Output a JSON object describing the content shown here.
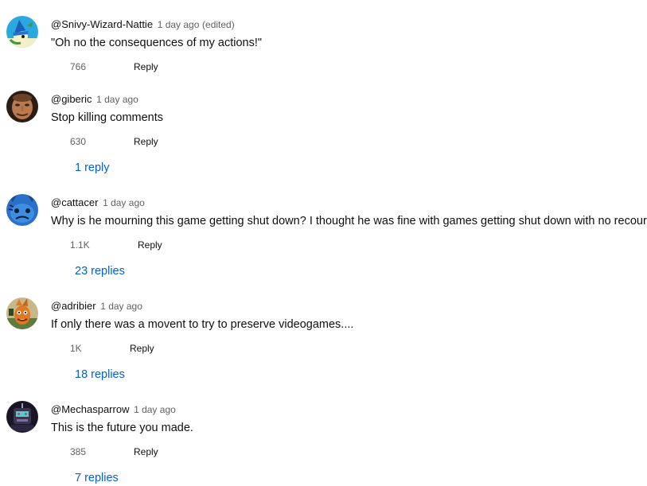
{
  "comments": [
    {
      "author": "@Snivy-Wizard-Nattie",
      "time": "1 day ago",
      "edited": "(edited)",
      "text": "\"Oh no the consequences of my actions!\"",
      "likes": "766",
      "reply_label": "Reply",
      "replies": ""
    },
    {
      "author": "@giberic",
      "time": "1 day ago",
      "edited": "",
      "text": "Stop killing comments",
      "likes": "630",
      "reply_label": "Reply",
      "replies": "1 reply"
    },
    {
      "author": "@cattacer",
      "time": "1 day ago",
      "edited": "",
      "text": "Why is he mourning this game getting shut down? I thought he was fine with games getting shut down with no recourse",
      "likes": "1.1K",
      "reply_label": "Reply",
      "replies": "23 replies"
    },
    {
      "author": "@adribier",
      "time": "1 day ago",
      "edited": "",
      "text": "If only there was a movent to try to preserve videogames....",
      "likes": "1K",
      "reply_label": "Reply",
      "replies": "18 replies"
    },
    {
      "author": "@Mechasparrow",
      "time": "1 day ago",
      "edited": "",
      "text": "This is the future you made.",
      "likes": "385",
      "reply_label": "Reply",
      "replies": "7 replies"
    }
  ],
  "colors": {
    "link": "#065fd4",
    "secondary_text": "#606060",
    "primary_text": "#0f0f0f"
  },
  "icons": {
    "avatar_1": "wizard-snivy-avatar-icon",
    "avatar_2": "face-avatar-icon",
    "avatar_3": "blue-creature-avatar-icon",
    "avatar_4": "bandicoot-avatar-icon",
    "avatar_5": "robot-avatar-icon"
  }
}
